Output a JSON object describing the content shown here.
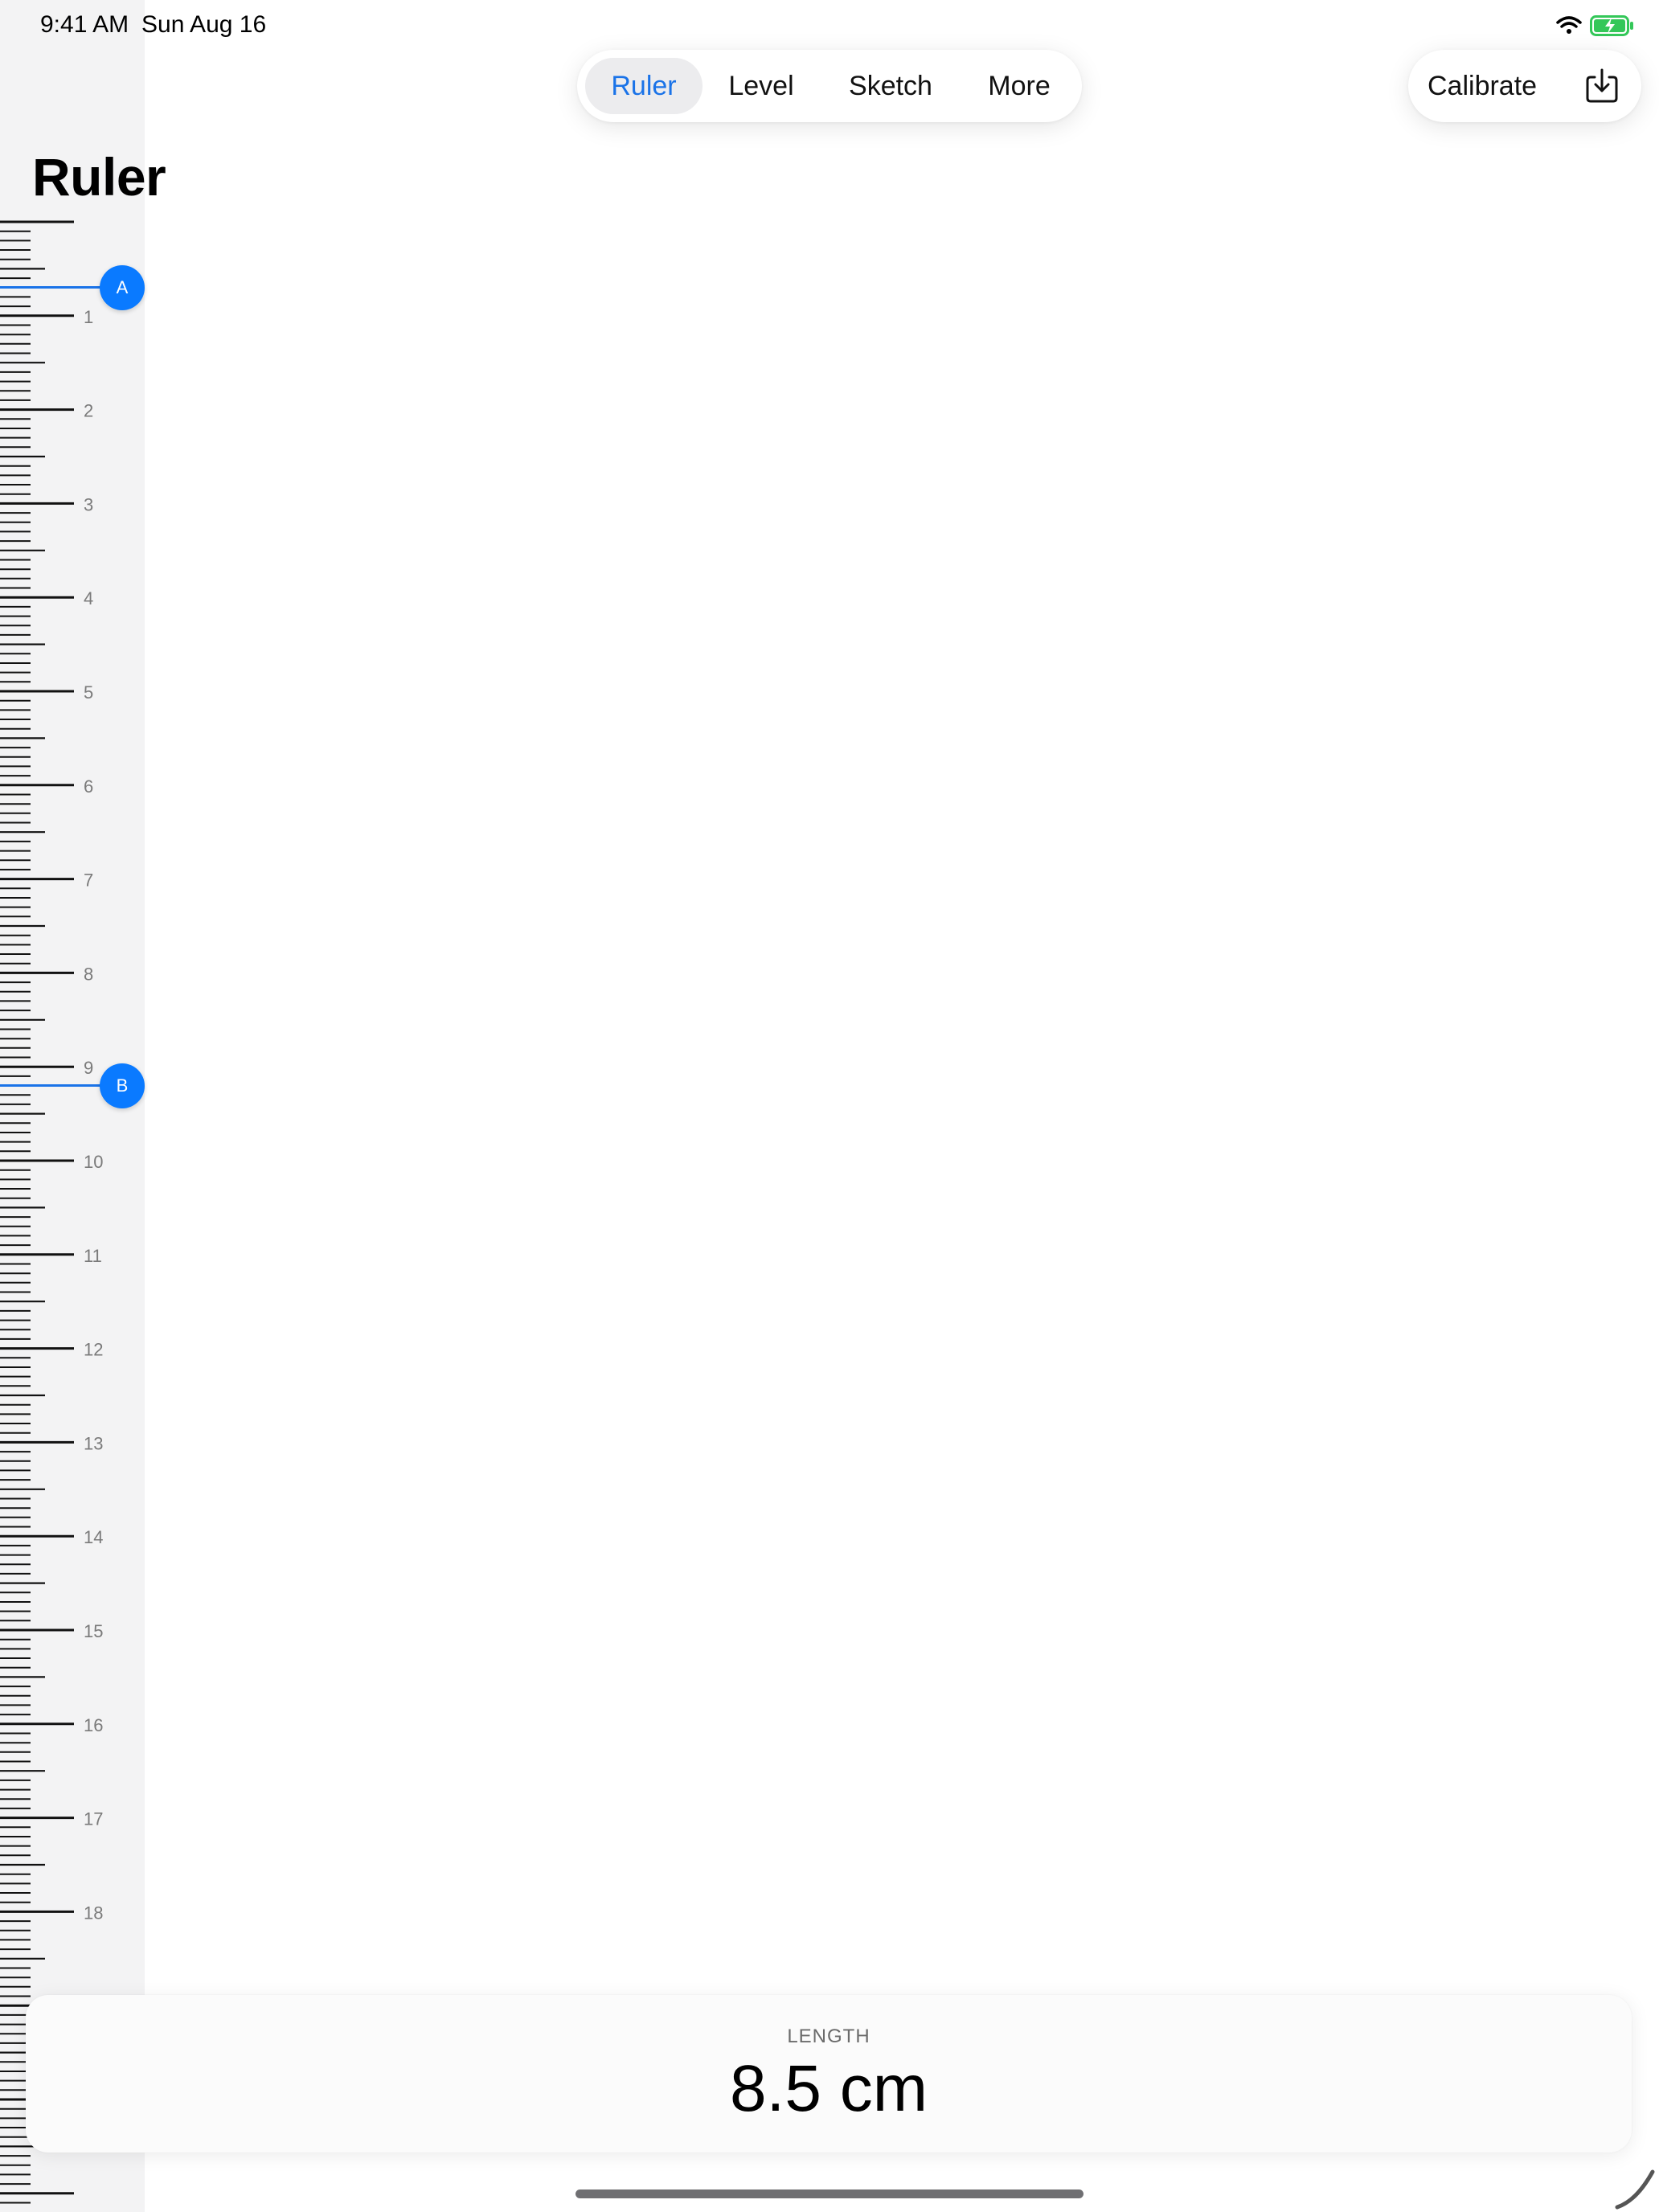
{
  "status_bar": {
    "time": "9:41 AM",
    "date": "Sun Aug 16",
    "icons": [
      "wifi-icon",
      "battery-charging-icon"
    ],
    "battery_color": "#34c759"
  },
  "title": "Ruler",
  "tabs": [
    {
      "label": "Ruler",
      "active": true
    },
    {
      "label": "Level",
      "active": false
    },
    {
      "label": "Sketch",
      "active": false
    },
    {
      "label": "More",
      "active": false
    }
  ],
  "toolbar": {
    "calibrate_label": "Calibrate",
    "export_icon": "export-icon"
  },
  "ruler": {
    "unit_labels": [
      "1",
      "2",
      "3",
      "4",
      "5",
      "6",
      "7",
      "8",
      "9",
      "10",
      "11",
      "12",
      "13",
      "14",
      "15",
      "16",
      "17",
      "18"
    ],
    "marker_a": {
      "label": "A",
      "position_cm": 0.7
    },
    "marker_b": {
      "label": "B",
      "position_cm": 9.2
    }
  },
  "measurement": {
    "label": "LENGTH",
    "value": "8.5 cm"
  },
  "colors": {
    "accent": "#0a7aff",
    "active_tab_text": "#1a73e8",
    "ruler_background": "#f3f3f4"
  }
}
